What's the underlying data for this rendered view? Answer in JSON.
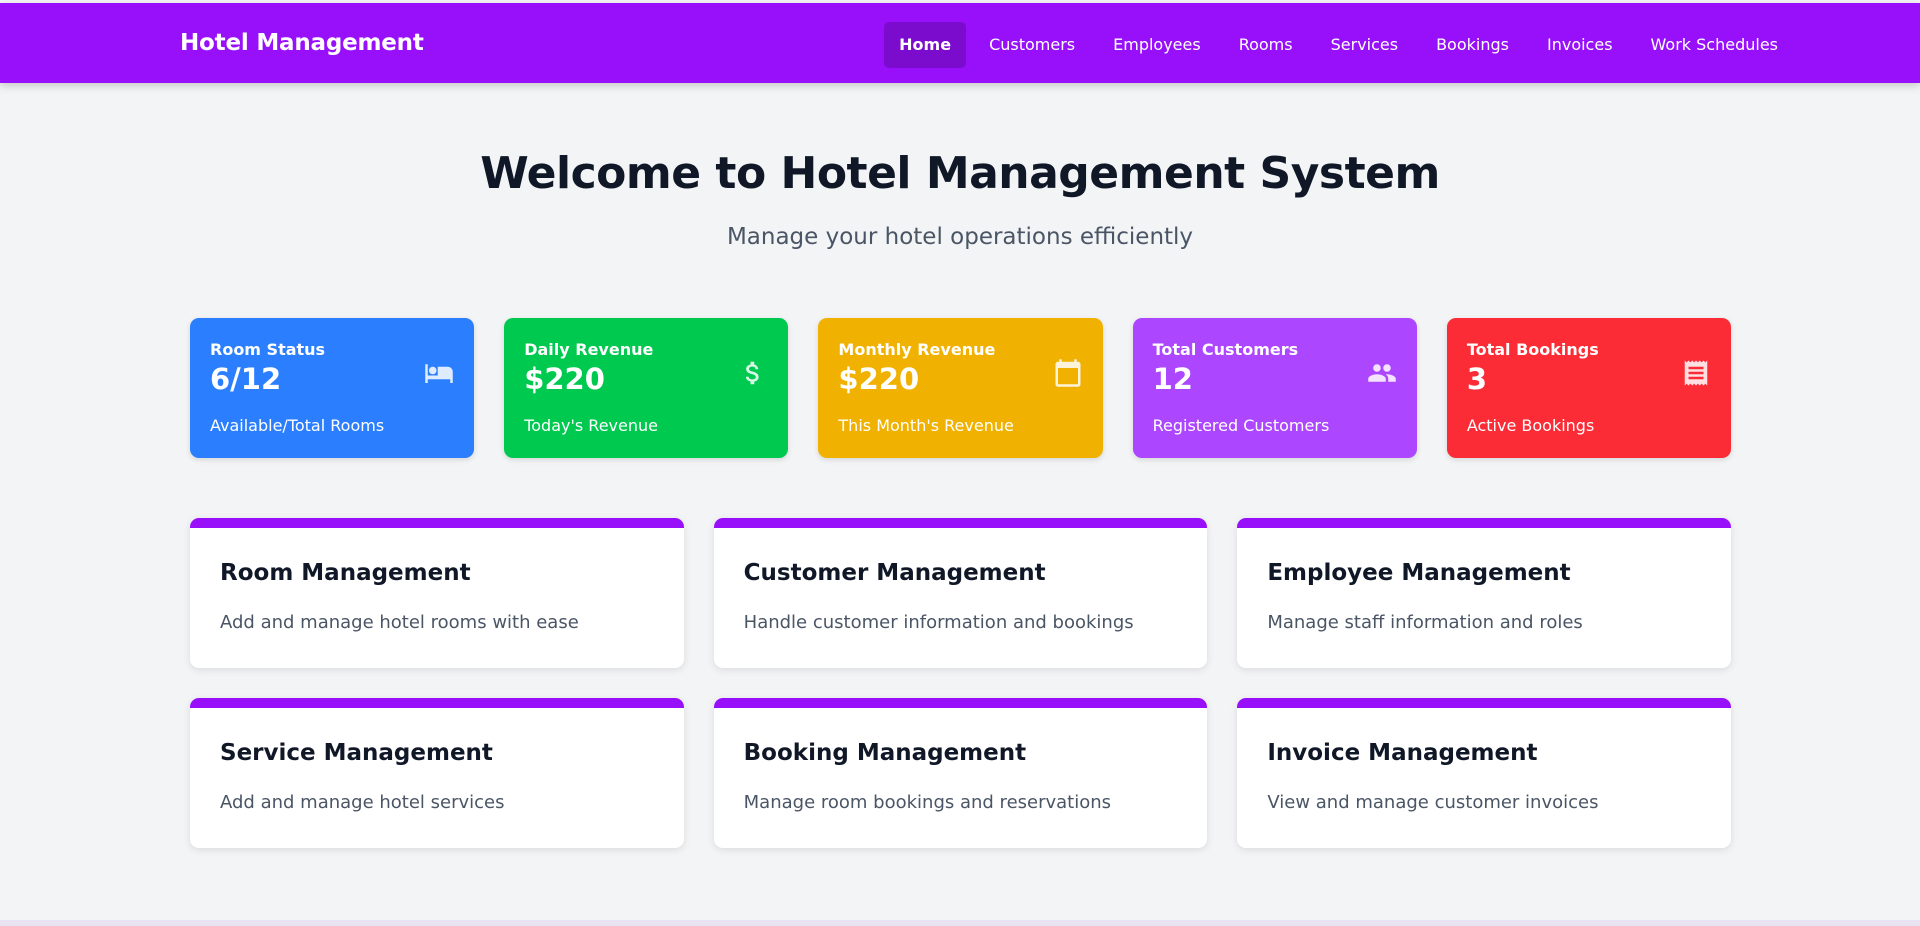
{
  "header": {
    "brand": "Hotel Management",
    "nav": [
      "Home",
      "Customers",
      "Employees",
      "Rooms",
      "Services",
      "Bookings",
      "Invoices",
      "Work Schedules"
    ],
    "active_index": 0
  },
  "hero": {
    "title": "Welcome to Hotel Management System",
    "subtitle": "Manage your hotel operations efficiently"
  },
  "stats": [
    {
      "label": "Room Status",
      "value": "6/12",
      "desc": "Available/Total Rooms",
      "icon": "bed-icon",
      "color": "#2b7fff"
    },
    {
      "label": "Daily Revenue",
      "value": "$220",
      "desc": "Today's Revenue",
      "icon": "dollar-icon",
      "color": "#00c950"
    },
    {
      "label": "Monthly Revenue",
      "value": "$220",
      "desc": "This Month's Revenue",
      "icon": "calendar-icon",
      "color": "#f0b100"
    },
    {
      "label": "Total Customers",
      "value": "12",
      "desc": "Registered Customers",
      "icon": "users-icon",
      "color": "#ad46ff"
    },
    {
      "label": "Total Bookings",
      "value": "3",
      "desc": "Active Bookings",
      "icon": "receipt-icon",
      "color": "#fb2c36"
    }
  ],
  "modules": [
    {
      "title": "Room Management",
      "desc": "Add and manage hotel rooms with ease"
    },
    {
      "title": "Customer Management",
      "desc": "Handle customer information and bookings"
    },
    {
      "title": "Employee Management",
      "desc": "Manage staff information and roles"
    },
    {
      "title": "Service Management",
      "desc": "Add and manage hotel services"
    },
    {
      "title": "Booking Management",
      "desc": "Manage room bookings and reservations"
    },
    {
      "title": "Invoice Management",
      "desc": "View and manage customer invoices"
    }
  ],
  "colors": {
    "primary": "#9810fa",
    "active_nav": "#7c0ccd",
    "background": "#f3f4f6"
  }
}
